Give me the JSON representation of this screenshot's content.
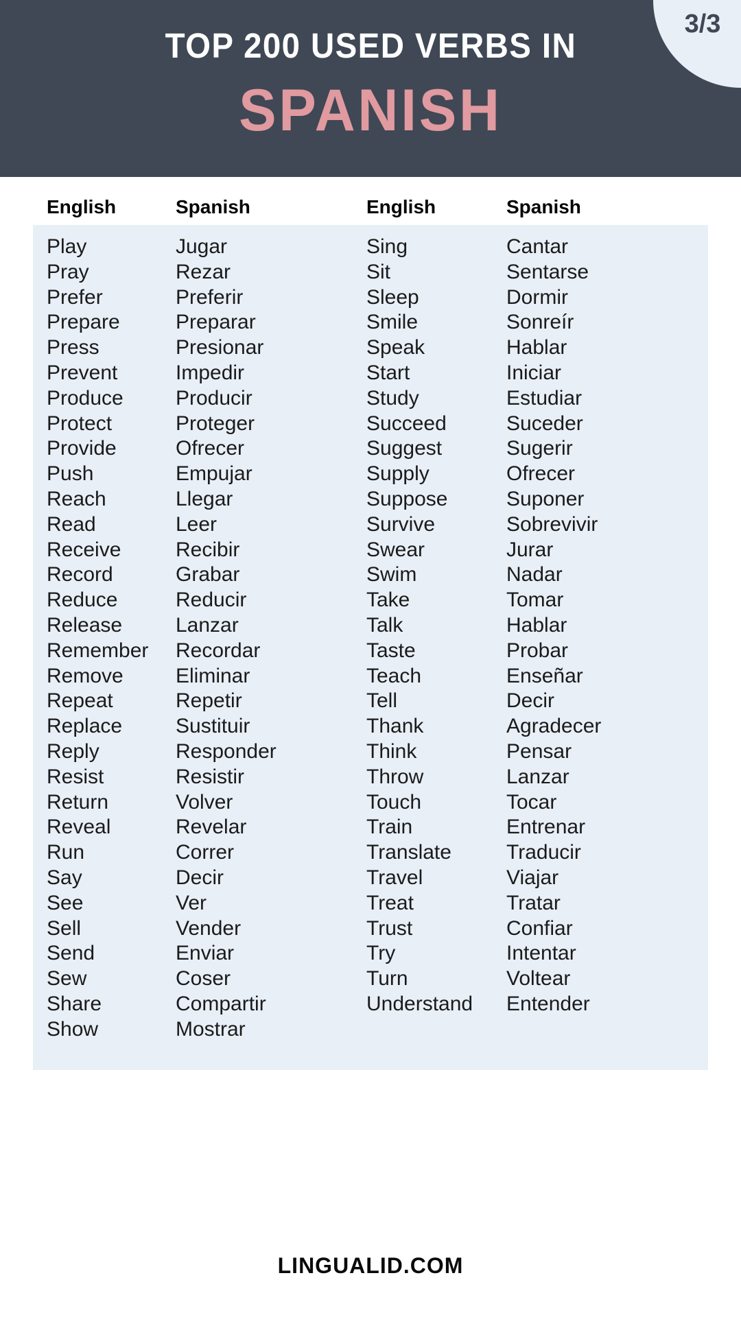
{
  "header": {
    "title": "TOP 200 USED VERBS IN",
    "subtitle": "SPANISH",
    "badge": "3/3",
    "bg_color": "#3f4854",
    "subtitle_color": "#e09aa0",
    "badge_bg_color": "#e8eff7"
  },
  "table": {
    "body_bg_color": "#e8eff7",
    "headers": [
      "English",
      "Spanish",
      "English",
      "Spanish"
    ],
    "left_pairs": [
      [
        "Play",
        "Jugar"
      ],
      [
        "Pray",
        "Rezar"
      ],
      [
        "Prefer",
        "Preferir"
      ],
      [
        "Prepare",
        "Preparar"
      ],
      [
        "Press",
        "Presionar"
      ],
      [
        "Prevent",
        "Impedir"
      ],
      [
        "Produce",
        "Producir"
      ],
      [
        "Protect",
        "Proteger"
      ],
      [
        "Provide",
        "Ofrecer"
      ],
      [
        "Push",
        "Empujar"
      ],
      [
        "Reach",
        "Llegar"
      ],
      [
        "Read",
        "Leer"
      ],
      [
        "Receive",
        "Recibir"
      ],
      [
        "Record",
        "Grabar"
      ],
      [
        "Reduce",
        "Reducir"
      ],
      [
        "Release",
        "Lanzar"
      ],
      [
        "Remember",
        "Recordar"
      ],
      [
        "Remove",
        "Eliminar"
      ],
      [
        "Repeat",
        "Repetir"
      ],
      [
        "Replace",
        "Sustituir"
      ],
      [
        "Reply",
        "Responder"
      ],
      [
        "Resist",
        "Resistir"
      ],
      [
        "Return",
        "Volver"
      ],
      [
        "Reveal",
        "Revelar"
      ],
      [
        "Run",
        "Correr"
      ],
      [
        "Say",
        "Decir"
      ],
      [
        "See",
        "Ver"
      ],
      [
        "Sell",
        "Vender"
      ],
      [
        "Send",
        "Enviar"
      ],
      [
        "Sew",
        "Coser"
      ],
      [
        "Share",
        "Compartir"
      ],
      [
        "Show",
        "Mostrar"
      ]
    ],
    "right_pairs": [
      [
        "Sing",
        "Cantar"
      ],
      [
        "Sit",
        "Sentarse"
      ],
      [
        "Sleep",
        "Dormir"
      ],
      [
        "Smile",
        "Sonreír"
      ],
      [
        "Speak",
        "Hablar"
      ],
      [
        "Start",
        "Iniciar"
      ],
      [
        "Study",
        "Estudiar"
      ],
      [
        "Succeed",
        "Suceder"
      ],
      [
        "Suggest",
        "Sugerir"
      ],
      [
        "Supply",
        "Ofrecer"
      ],
      [
        "Suppose",
        "Suponer"
      ],
      [
        "Survive",
        "Sobrevivir"
      ],
      [
        "Swear",
        "Jurar"
      ],
      [
        "Swim",
        "Nadar"
      ],
      [
        "Take",
        "Tomar"
      ],
      [
        "Talk",
        "Hablar"
      ],
      [
        "Taste",
        "Probar"
      ],
      [
        "Teach",
        "Enseñar"
      ],
      [
        "Tell",
        "Decir"
      ],
      [
        "Thank",
        "Agradecer"
      ],
      [
        "Think",
        "Pensar"
      ],
      [
        "Throw",
        "Lanzar"
      ],
      [
        "Touch",
        "Tocar"
      ],
      [
        "Train",
        "Entrenar"
      ],
      [
        "Translate",
        "Traducir"
      ],
      [
        "Travel",
        "Viajar"
      ],
      [
        "Treat",
        "Tratar"
      ],
      [
        "Trust",
        "Confiar"
      ],
      [
        "Try",
        "Intentar"
      ],
      [
        "Turn",
        "Voltear"
      ],
      [
        "Understand",
        "Entender"
      ]
    ]
  },
  "footer": {
    "site": "LINGUALID.COM"
  }
}
